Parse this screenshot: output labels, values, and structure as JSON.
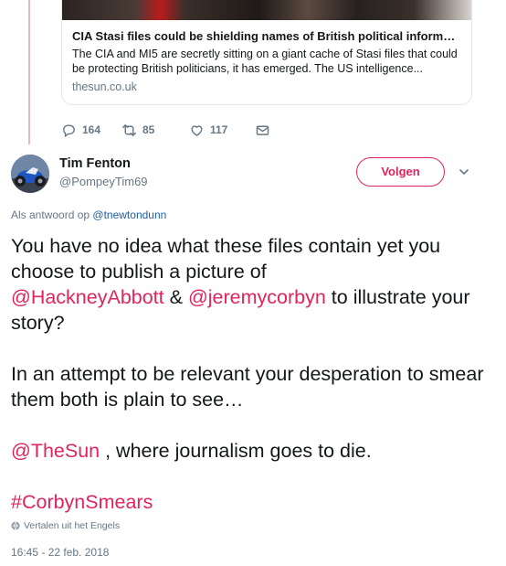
{
  "card": {
    "title": "CIA Stasi files could be shielding names of British political informan...",
    "description": "The CIA and MI5 are secretly sitting on a giant cache of Stasi files that could be protecting British politicians, it has emerged. The US intelligence...",
    "domain": "thesun.co.uk"
  },
  "actions": {
    "replies": "164",
    "retweets": "85",
    "likes": "117"
  },
  "tweet": {
    "author_name": "Tim Fenton",
    "author_handle": "@PompeyTim69",
    "follow_label": "Volgen",
    "reply_prefix": "Als antwoord op",
    "reply_handle": "@tnewtondunn",
    "text_1a": "You have no idea what these files contain yet you choose to publish a picture of",
    "mention_1": "@HackneyAbbott",
    "text_1b": " & ",
    "mention_2": "@jeremycorbyn",
    "text_1c": " to illustrate your story?",
    "text_2": "In an attempt to be relevant your desperation to smear them both is plain to see…",
    "mention_3": "@TheSun",
    "text_3": " , where journalism goes to die.",
    "hashtag": "#CorbynSmears",
    "translate_label": "Vertalen uit het Engels",
    "timestamp": "16:45 - 22 feb. 2018"
  },
  "colors": {
    "accent": "#e0245e",
    "link": "#1b5fa6",
    "muted": "#657786",
    "thread_line": "#e8b7bf"
  },
  "icons": [
    "reply-icon",
    "retweet-icon",
    "like-icon",
    "direct-message-icon",
    "chevron-down-icon",
    "globe-icon"
  ]
}
